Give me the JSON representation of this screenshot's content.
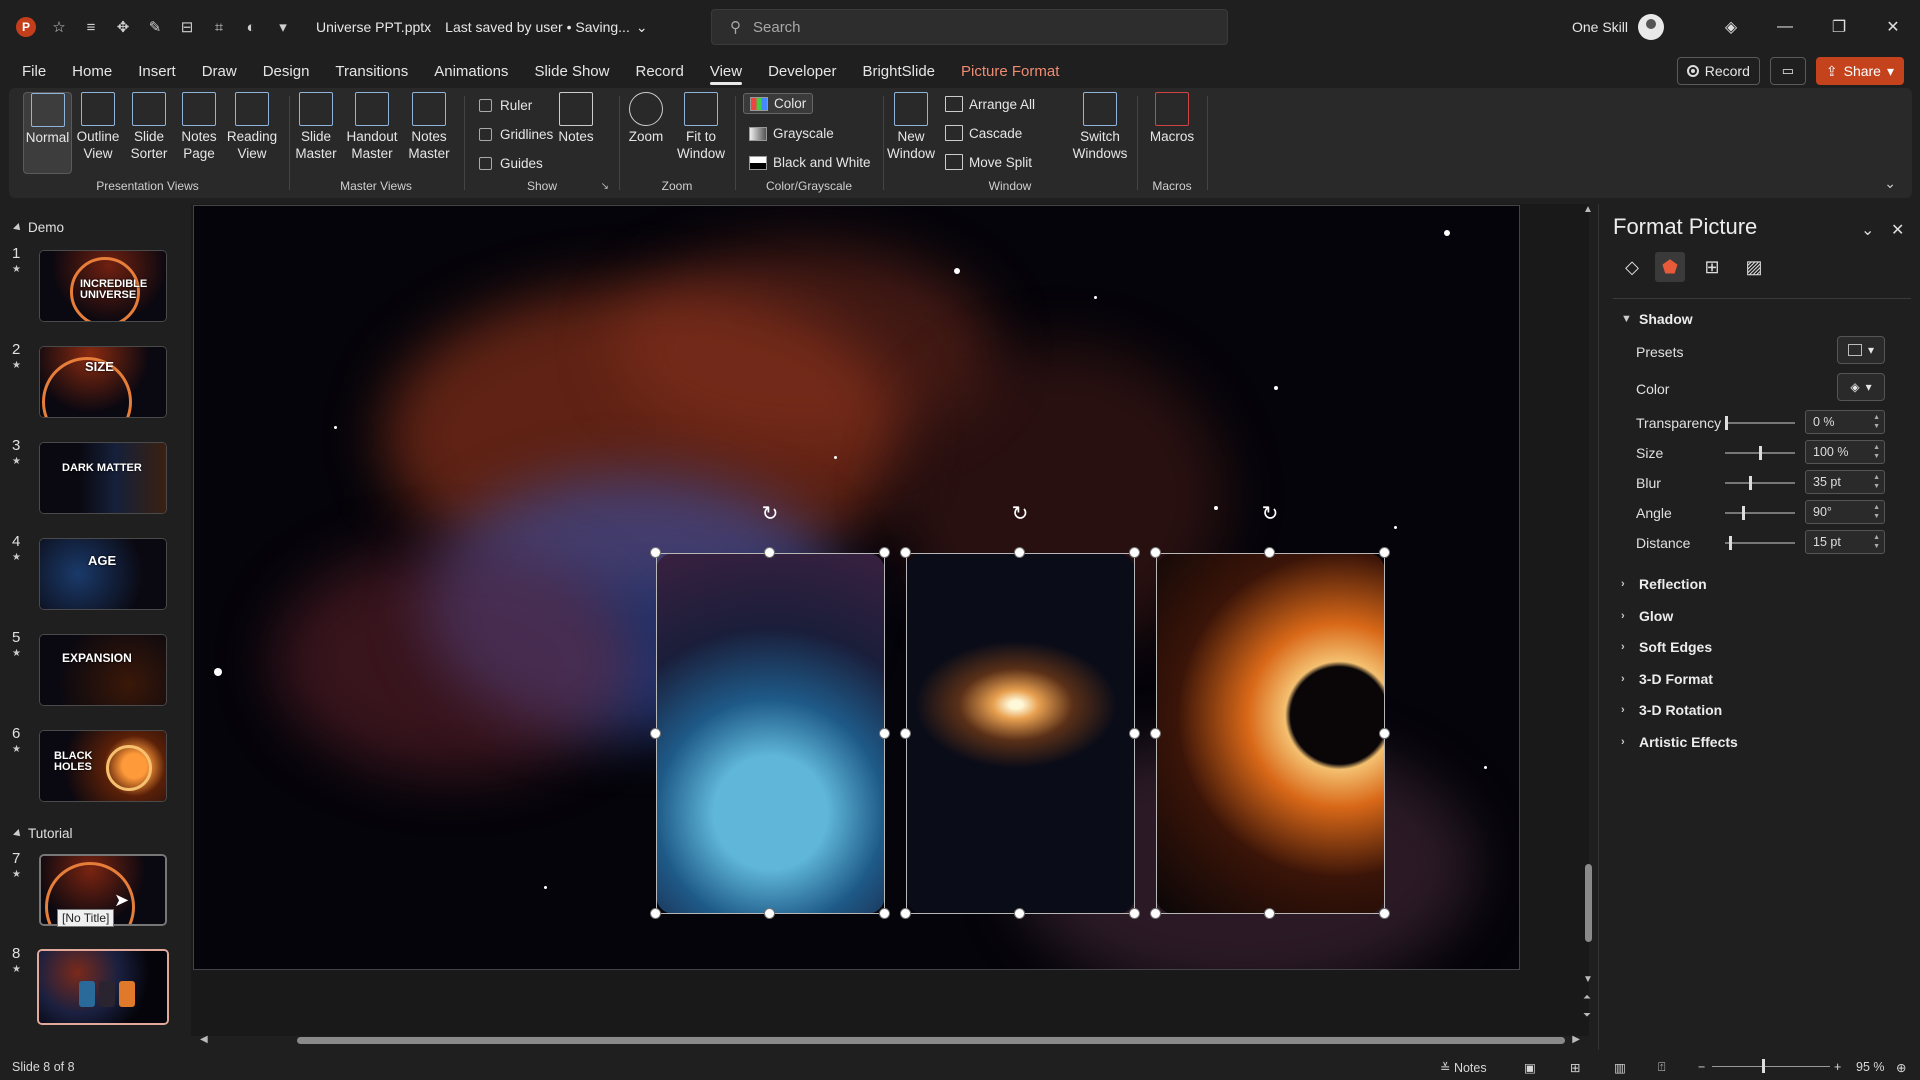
{
  "app": {
    "logo": "P",
    "doc_title": "Universe PPT.pptx",
    "save_status": "Last saved by user • Saving..."
  },
  "search": {
    "placeholder": "Search"
  },
  "user": {
    "name": "One Skill"
  },
  "menu": {
    "tabs": [
      "File",
      "Home",
      "Insert",
      "Draw",
      "Design",
      "Transitions",
      "Animations",
      "Slide Show",
      "Record",
      "View",
      "Developer",
      "BrightSlide",
      "Picture Format"
    ],
    "active": "View",
    "record_label": "Record",
    "share_label": "Share"
  },
  "ribbon": {
    "presentation_views": {
      "label": "Presentation Views",
      "buttons": [
        "Normal",
        "Outline View",
        "Slide Sorter",
        "Notes Page",
        "Reading View"
      ]
    },
    "master_views": {
      "label": "Master Views",
      "buttons": [
        "Slide Master",
        "Handout Master",
        "Notes Master"
      ]
    },
    "show": {
      "label": "Show",
      "checks": [
        "Ruler",
        "Gridlines",
        "Guides"
      ],
      "notes": "Notes"
    },
    "zoom": {
      "label": "Zoom",
      "buttons": [
        "Zoom",
        "Fit to Window"
      ]
    },
    "color": {
      "label": "Color/Grayscale",
      "items": [
        "Color",
        "Grayscale",
        "Black and White"
      ]
    },
    "window": {
      "label": "Window",
      "new_window": "New Window",
      "items": [
        "Arrange All",
        "Cascade",
        "Move Split"
      ],
      "switch": "Switch Windows"
    },
    "macros": {
      "label": "Macros",
      "button": "Macros"
    }
  },
  "slides_panel": {
    "sections": [
      "Demo",
      "Tutorial"
    ],
    "slides": [
      {
        "num": "1",
        "caption": "INCREDIBLE UNIVERSE"
      },
      {
        "num": "2",
        "caption": "SIZE"
      },
      {
        "num": "3",
        "caption": "DARK MATTER"
      },
      {
        "num": "4",
        "caption": "AGE"
      },
      {
        "num": "5",
        "caption": "EXPANSION"
      },
      {
        "num": "6",
        "caption": "BLACK HOLES"
      },
      {
        "num": "7",
        "caption": ""
      },
      {
        "num": "8",
        "caption": ""
      }
    ],
    "tooltip": "[No Title]",
    "selected": "8"
  },
  "format_panel": {
    "title": "Format Picture",
    "sections": {
      "shadow": "Shadow",
      "reflection": "Reflection",
      "glow": "Glow",
      "soft_edges": "Soft Edges",
      "format_3d": "3-D Format",
      "rotation_3d": "3-D Rotation",
      "artistic": "Artistic Effects"
    },
    "rows": {
      "presets": "Presets",
      "color": "Color",
      "transparency": "Transparency",
      "size": "Size",
      "blur": "Blur",
      "angle": "Angle",
      "distance": "Distance"
    },
    "values": {
      "transparency": "0 %",
      "size": "100 %",
      "blur": "35 pt",
      "angle": "90°",
      "distance": "15 pt"
    }
  },
  "status": {
    "slide_info": "Slide 8 of 8",
    "notes": "Notes",
    "zoom": "95 %"
  },
  "colors": {
    "accent": "#c4421c",
    "context_tab": "#f08b73",
    "selected_thumb": "#e2a89a"
  }
}
